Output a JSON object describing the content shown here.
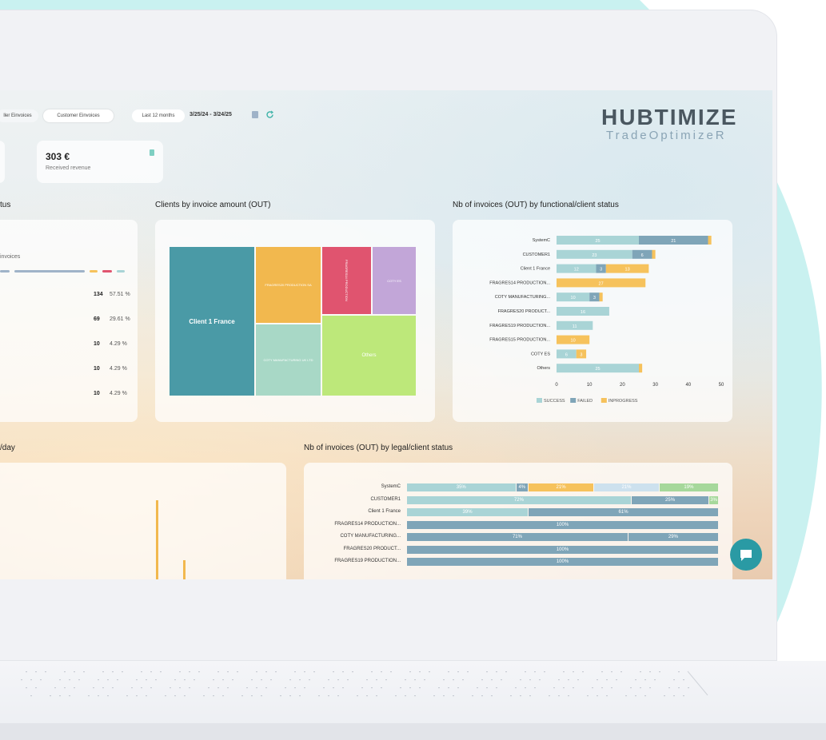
{
  "header": {
    "tabs": [
      {
        "label": "ller Einvoices"
      },
      {
        "label": "Customer Einvoices"
      }
    ],
    "period_label": "Last 12 months",
    "date_range": "3/25/24 - 3/24/25",
    "logo_main": "HUBTIMIZE",
    "logo_sub": "TradeOptimizeR"
  },
  "kpi": {
    "value": "303 €",
    "label": "Received revenue"
  },
  "left_panel": {
    "title_fragment": "tus",
    "invoices_label": "invoices",
    "rows": [
      {
        "count": "134",
        "pct": "57.51 %"
      },
      {
        "count": "69",
        "pct": "29.61 %"
      },
      {
        "count": "10",
        "pct": "4.29 %"
      },
      {
        "count": "10",
        "pct": "4.29 %"
      },
      {
        "count": "10",
        "pct": "4.29 %"
      }
    ]
  },
  "treemap": {
    "title": "Clients by invoice amount (OUT)",
    "cells": [
      {
        "label": "Client 1 France",
        "color": "#4a9aa6"
      },
      {
        "label": "FRAGRES20 PRODUCTION SA",
        "color": "#f2b84e"
      },
      {
        "label": "FRAGRES14 PRODUCTION",
        "color": "#e0546f"
      },
      {
        "label": "COTY ES",
        "color": "#c2a6d8"
      },
      {
        "label": "COTY MANUFACTURING UK LTD",
        "color": "#a8d8c6"
      },
      {
        "label": "Others",
        "color": "#bde87a"
      }
    ]
  },
  "functional_chart": {
    "title": "Nb of invoices (OUT) by functional/client status",
    "categories": [
      "SystemC",
      "CUSTOMER1",
      "Client 1 France",
      "FRAGRES14 PRODUCTION...",
      "COTY MANUFACTURING...",
      "FRAGRES20 PRODUCT...",
      "FRAGRES19 PRODUCTION...",
      "FRAGRES15 PRODUCTION...",
      "COTY ES",
      "Others"
    ],
    "x_ticks": [
      "0",
      "10",
      "20",
      "30",
      "40",
      "50"
    ],
    "legend": [
      "SUCCESS",
      "FAILED",
      "INPROGRESS"
    ],
    "colors": {
      "success": "#a9d4d6",
      "failed": "#7fa5b8",
      "inprogress": "#f6c25c"
    }
  },
  "chart_data": [
    {
      "type": "bar",
      "title": "Nb of invoices (OUT) by functional/client status",
      "categories": [
        "SystemC",
        "CUSTOMER1",
        "Client 1 France",
        "FRAGRES14 PRODUCTION...",
        "COTY MANUFACTURING...",
        "FRAGRES20 PRODUCT...",
        "FRAGRES19 PRODUCTION...",
        "FRAGRES15 PRODUCTION...",
        "COTY ES",
        "Others"
      ],
      "series": [
        {
          "name": "SUCCESS",
          "values": [
            25,
            23,
            12,
            0,
            10,
            16,
            11,
            0,
            6,
            25
          ]
        },
        {
          "name": "FAILED",
          "values": [
            21,
            6,
            3,
            0,
            3,
            0,
            0,
            0,
            0,
            0
          ]
        },
        {
          "name": "INPROGRESS",
          "values": [
            1,
            1,
            13,
            27,
            1,
            0,
            0,
            10,
            3,
            1
          ]
        }
      ],
      "xlim": [
        0,
        50
      ],
      "orientation": "horizontal",
      "stacked": true,
      "legend": "bottom"
    },
    {
      "type": "bar",
      "title": "Nb of invoices (OUT) by legal/client status",
      "categories": [
        "SystemC",
        "CUSTOMER1",
        "Client 1 France",
        "FRAGRES14 PRODUCTION...",
        "COTY MANUFACTURING...",
        "FRAGRES20 PRODUCT...",
        "FRAGRES19 PRODUCTION..."
      ],
      "series": [
        {
          "values": [
            35,
            72,
            39,
            100,
            71,
            100,
            100
          ]
        },
        {
          "values": [
            4,
            25,
            61,
            0,
            29,
            0,
            0
          ]
        },
        {
          "values": [
            21,
            3,
            0,
            0,
            0,
            0,
            0
          ]
        },
        {
          "values": [
            21,
            0,
            0,
            0,
            0,
            0,
            0
          ]
        },
        {
          "values": [
            19,
            0,
            0,
            0,
            0,
            0,
            0
          ]
        }
      ],
      "xlim": [
        0,
        100
      ],
      "orientation": "horizontal",
      "stacked": true
    }
  ],
  "legal_chart": {
    "title": "Nb of invoices (OUT) by legal/client status",
    "categories": [
      "SystemC",
      "CUSTOMER1",
      "Client 1 France",
      "FRAGRES14 PRODUCTION...",
      "COTY MANUFACTURING...",
      "FRAGRES20 PRODUCT...",
      "FRAGRES19 PRODUCTION..."
    ],
    "rows": [
      [
        {
          "t": "35%",
          "w": 35,
          "c": "#a9d4d6"
        },
        {
          "t": "4%",
          "w": 4,
          "c": "#7fa5b8"
        },
        {
          "t": "21%",
          "w": 21,
          "c": "#f6c25c"
        },
        {
          "t": "21%",
          "w": 21,
          "c": "#cde1ee"
        },
        {
          "t": "19%",
          "w": 19,
          "c": "#a6d89b"
        }
      ],
      [
        {
          "t": "72%",
          "w": 72,
          "c": "#a9d4d6"
        },
        {
          "t": "25%",
          "w": 25,
          "c": "#7fa5b8"
        },
        {
          "t": "3%",
          "w": 3,
          "c": "#a6d89b"
        }
      ],
      [
        {
          "t": "39%",
          "w": 39,
          "c": "#a9d4d6"
        },
        {
          "t": "61%",
          "w": 61,
          "c": "#7fa5b8"
        }
      ],
      [
        {
          "t": "100%",
          "w": 100,
          "c": "#7fa5b8"
        }
      ],
      [
        {
          "t": "71%",
          "w": 71,
          "c": "#7fa5b8"
        },
        {
          "t": "29%",
          "w": 29,
          "c": "#7fa5b8"
        }
      ],
      [
        {
          "t": "100%",
          "w": 100,
          "c": "#7fa5b8"
        }
      ],
      [
        {
          "t": "100%",
          "w": 100,
          "c": "#7fa5b8"
        }
      ]
    ]
  },
  "bottom_left": {
    "title_fragment": "/day"
  }
}
